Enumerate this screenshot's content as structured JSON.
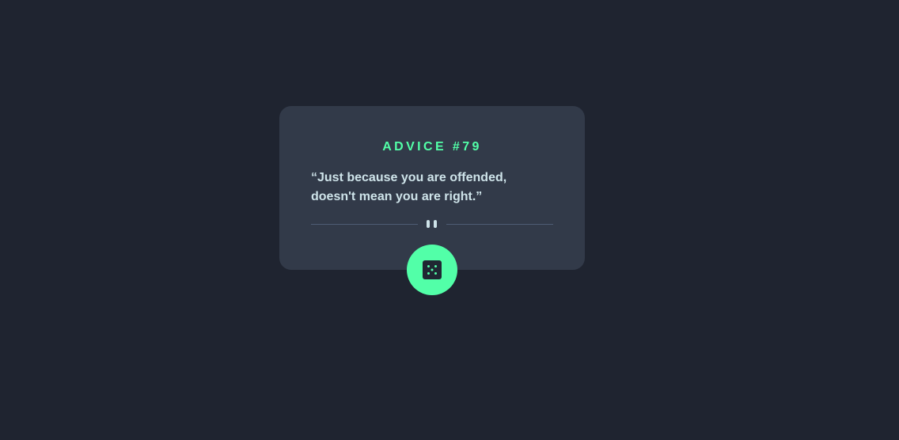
{
  "card": {
    "heading": "ADVICE #79",
    "quote": "“Just because you are offended, doesn't mean you are right.”"
  },
  "divider": {
    "icon": "pause-icon"
  },
  "button": {
    "icon": "dice-icon"
  },
  "colors": {
    "background": "#1f2430",
    "card": "#323a49",
    "accent": "#52ffa8",
    "text": "#cee3e9",
    "divider": "#4f5d74"
  }
}
